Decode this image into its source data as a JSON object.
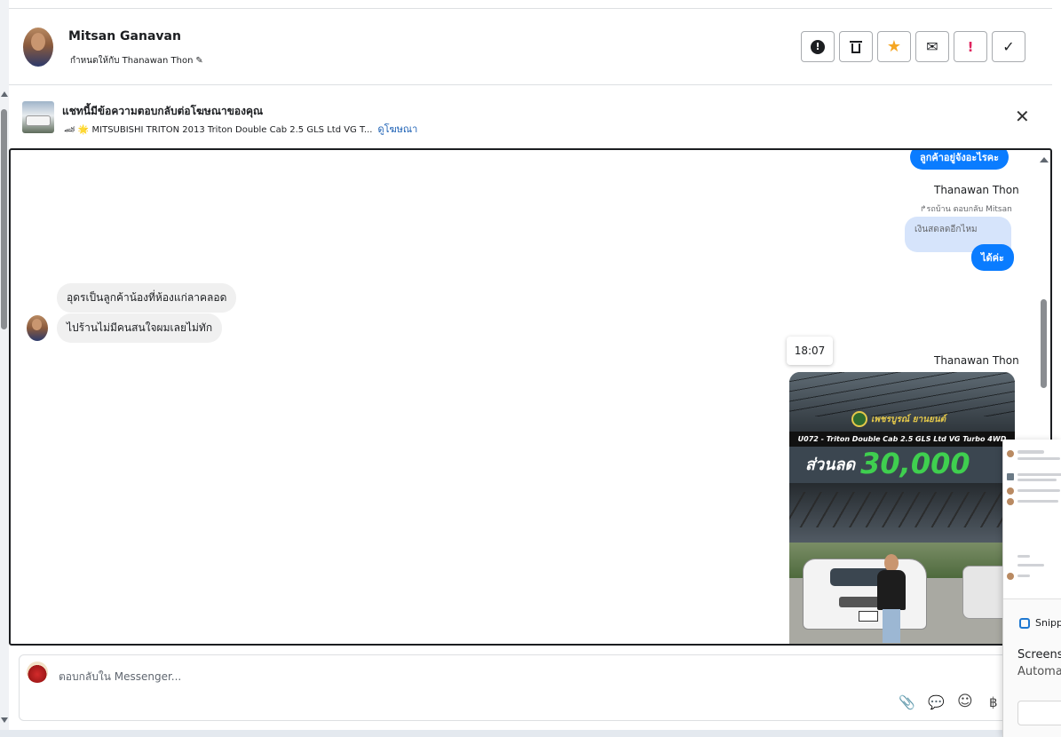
{
  "header": {
    "name": "Mitsan Ganavan",
    "assign_label": "กำหนดให้กับ Thanawan Thon",
    "pencil": "✎",
    "actions": [
      {
        "icon": "alert-circle-icon",
        "glyph": "!",
        "label": "spam"
      },
      {
        "icon": "trash-icon",
        "glyph": "🗑",
        "label": "delete"
      },
      {
        "icon": "star-icon",
        "glyph": "★",
        "label": "star"
      },
      {
        "icon": "envelope-icon",
        "glyph": "✉",
        "label": "mark-unread"
      },
      {
        "icon": "exclamation-icon",
        "glyph": "!",
        "label": "follow-up"
      },
      {
        "icon": "checkmark-icon",
        "glyph": "✓",
        "label": "done"
      }
    ]
  },
  "ad": {
    "title": "แชทนี้มีข้อความตอบกลับต่อโฆษณาของคุณ",
    "subtitle": "🏎 🌟 MITSUBISHI TRITON 2013 Triton Double Cab 2.5 GLS Ltd VG T...",
    "link": "ดูโฆษณา",
    "close": "✕"
  },
  "messages": {
    "out_top": "ลูกค้าอยู่จังอะไรคะ",
    "sender1": "Thanawan Thon",
    "reply_note": "↱รถบ้าน ตอบกลับ Mitsan",
    "quoted": "เงินสดลดอีกไหม",
    "out_reply": "ได้ค่ะ",
    "in1": "อุดรเป็นลูกค้าน้องที่ห้องแก่ลาคลอด",
    "in2": "ไปร้านไม่มีคนสนใจผมเลยไม่ทัก",
    "timestamp": "18:07",
    "sender2": "Thanawan Thon"
  },
  "promo": {
    "logo_text": "เพชรบูรณ์ ยานยนต์",
    "model_band": "U072 - Triton Double Cab 2.5 GLS Ltd VG Turbo 4WD",
    "discount_label": "ส่วนลด",
    "discount_value": "30,000"
  },
  "composer": {
    "placeholder": "ตอบกลับใน Messenger...",
    "tools": [
      {
        "icon": "paperclip-icon",
        "glyph": "📎"
      },
      {
        "icon": "saved-reply-icon",
        "glyph": "💬"
      },
      {
        "icon": "emoji-icon",
        "glyph": "☺"
      },
      {
        "icon": "baht-icon",
        "glyph": "฿"
      }
    ]
  },
  "snip": {
    "app_name": "Snipp",
    "line1": "Screensh",
    "line2": "Automat"
  },
  "colors": {
    "accent": "#0a7cff",
    "link": "#1a5fb4",
    "star": "#f5a623",
    "danger": "#e0245e",
    "discount": "#3fcf4f"
  }
}
